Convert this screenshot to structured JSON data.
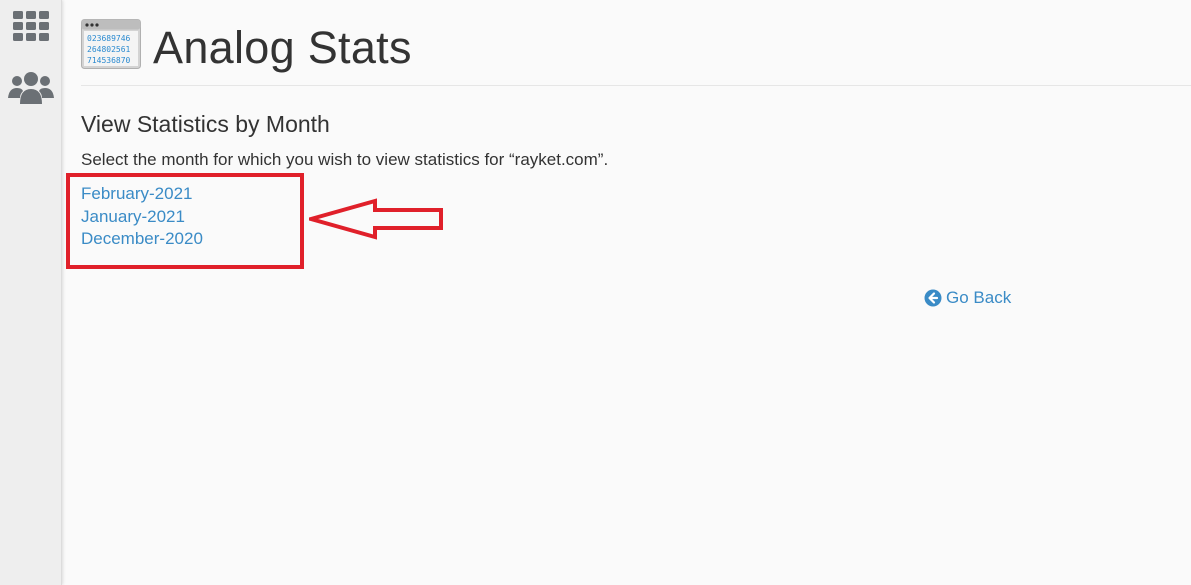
{
  "app": {
    "title": "Analog Stats",
    "icon_digits": [
      "023689746",
      "264802561",
      "714536870"
    ]
  },
  "sidebar": {
    "items": [
      {
        "icon": "grid-icon",
        "label": "Applications"
      },
      {
        "icon": "users-icon",
        "label": "Users"
      }
    ]
  },
  "section": {
    "title": "View Statistics by Month",
    "description": "Select the month for which you wish to view statistics for “rayket.com”."
  },
  "months": [
    {
      "label": "February-2021"
    },
    {
      "label": "January-2021"
    },
    {
      "label": "December-2020"
    }
  ],
  "actions": {
    "go_back_label": "Go Back"
  },
  "annotation": {
    "color": "#e0202a"
  },
  "colors": {
    "link": "#3a8bc6",
    "sidebar_bg": "#eeeeee",
    "sidebar_icon": "#6b7075"
  }
}
